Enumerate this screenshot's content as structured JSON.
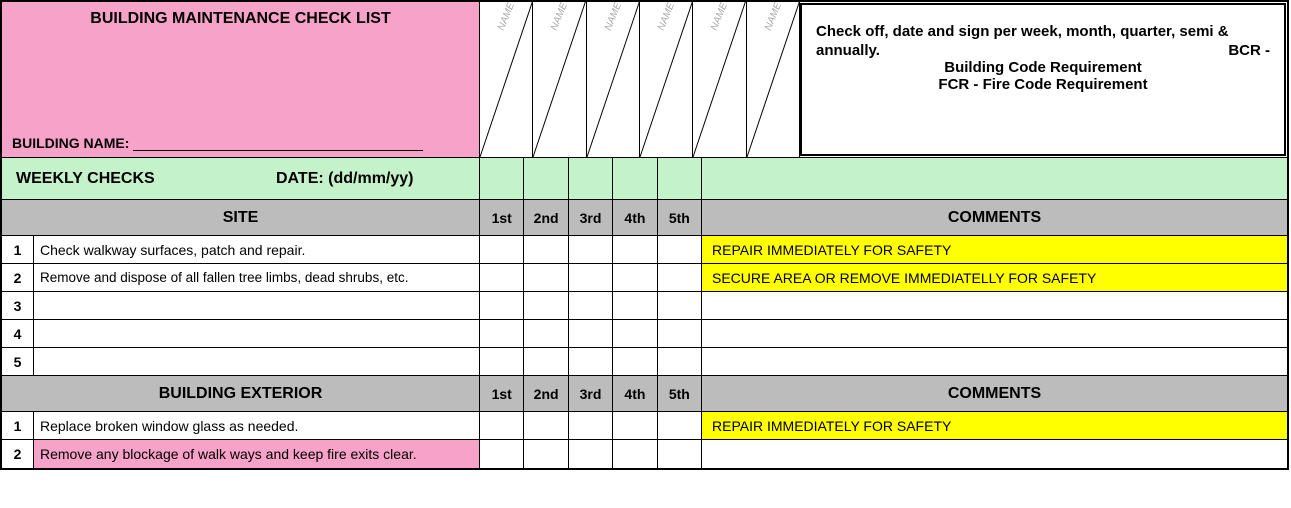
{
  "header": {
    "title": "BUILDING MAINTENANCE CHECK LIST",
    "building_name_label": "BUILDING NAME:",
    "name_placeholder": "NAME",
    "instructions_line1": "Check off, date and sign per week, month, quarter, semi &",
    "instructions_line2a": "annually.",
    "instructions_line2b": "BCR -",
    "instructions_line3": "Building Code Requirement",
    "instructions_line4": "FCR - Fire Code Requirement"
  },
  "weekly": {
    "label": "WEEKLY CHECKS",
    "date_label": "DATE: (dd/mm/yy)"
  },
  "columns": [
    "1st",
    "2nd",
    "3rd",
    "4th",
    "5th"
  ],
  "comments_label": "COMMENTS",
  "sections": [
    {
      "title": "SITE",
      "rows": [
        {
          "n": "1",
          "task": "Check walkway surfaces, patch and repair.",
          "comment": "REPAIR IMMEDIATELY FOR SAFETY",
          "hl": true
        },
        {
          "n": "2",
          "task": "Remove and dispose of all fallen tree limbs, dead shrubs, etc.",
          "comment": "SECURE AREA OR REMOVE IMMEDIATELLY FOR SAFETY",
          "hl": true,
          "twoline": true
        },
        {
          "n": "3",
          "task": "",
          "comment": ""
        },
        {
          "n": "4",
          "task": "",
          "comment": ""
        },
        {
          "n": "5",
          "task": "",
          "comment": ""
        }
      ]
    },
    {
      "title": "BUILDING EXTERIOR",
      "rows": [
        {
          "n": "1",
          "task": "Replace broken window glass as needed.",
          "comment": "REPAIR IMMEDIATELY FOR SAFETY",
          "hl": true
        },
        {
          "n": "2",
          "task": "Remove any blockage of walk ways and keep fire exits clear.",
          "comment": "",
          "pinktask": true
        }
      ]
    }
  ]
}
